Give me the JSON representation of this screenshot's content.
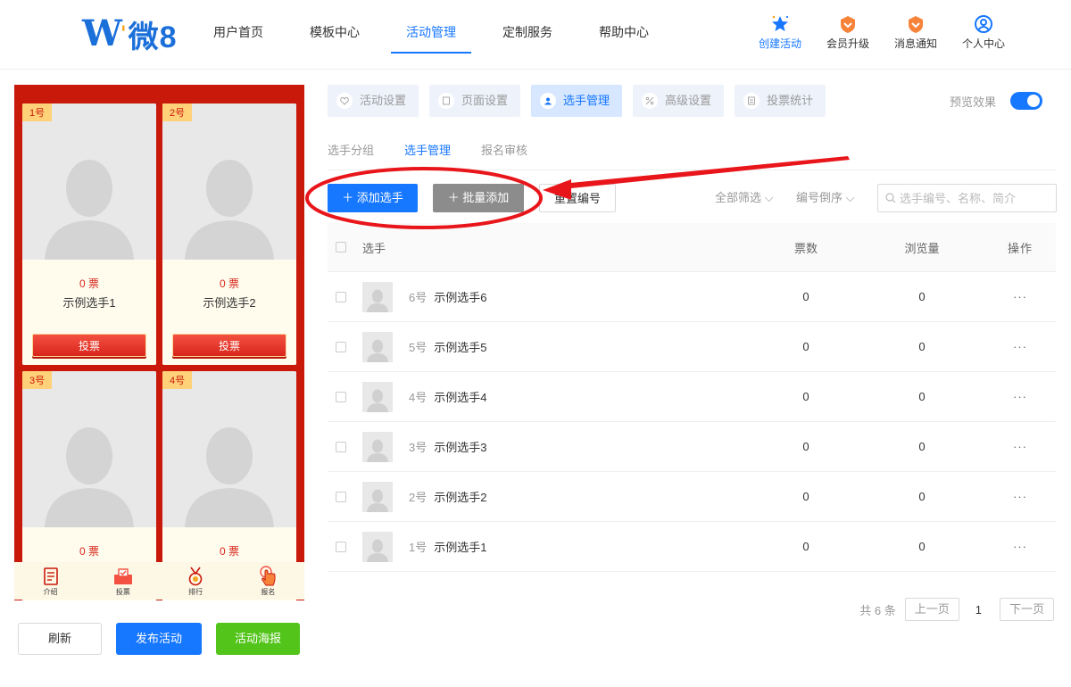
{
  "header": {
    "logo_text": "微8",
    "nav": [
      "用户首页",
      "模板中心",
      "活动管理",
      "定制服务",
      "帮助中心"
    ],
    "icons": [
      {
        "label": "创建活动",
        "icon": "star-icon"
      },
      {
        "label": "会员升级",
        "icon": "upgrade-icon"
      },
      {
        "label": "消息通知",
        "icon": "message-icon"
      },
      {
        "label": "个人中心",
        "icon": "user-icon"
      }
    ]
  },
  "preview": {
    "cards": [
      {
        "num": "1号",
        "votes": "0 票",
        "name": "示例选手1",
        "vote_btn": "投票"
      },
      {
        "num": "2号",
        "votes": "0 票",
        "name": "示例选手2",
        "vote_btn": "投票"
      },
      {
        "num": "3号",
        "votes": "0 票"
      },
      {
        "num": "4号",
        "votes": "0 票"
      }
    ],
    "bottom_bar": [
      "介绍",
      "投票",
      "排行",
      "报名"
    ]
  },
  "left_buttons": {
    "refresh": "刷新",
    "publish": "发布活动",
    "poster": "活动海报"
  },
  "top_tabs": [
    "活动设置",
    "页面设置",
    "选手管理",
    "高级设置",
    "投票统计"
  ],
  "preview_toggle_label": "预览效果",
  "sub_tabs": [
    "选手分组",
    "选手管理",
    "报名审核"
  ],
  "toolbar": {
    "add": "＋ 添加选手",
    "batch": "＋ 批量添加",
    "reset": "重置编号",
    "filter": "全部筛选",
    "sort": "编号倒序",
    "search_placeholder": "选手编号、名称、简介"
  },
  "table": {
    "headers": {
      "player": "选手",
      "votes": "票数",
      "views": "浏览量",
      "ops": "操作"
    },
    "rows": [
      {
        "num": "6号",
        "name": "示例选手6",
        "votes": "0",
        "views": "0",
        "ops": "···"
      },
      {
        "num": "5号",
        "name": "示例选手5",
        "votes": "0",
        "views": "0",
        "ops": "···"
      },
      {
        "num": "4号",
        "name": "示例选手4",
        "votes": "0",
        "views": "0",
        "ops": "···"
      },
      {
        "num": "3号",
        "name": "示例选手3",
        "votes": "0",
        "views": "0",
        "ops": "···"
      },
      {
        "num": "2号",
        "name": "示例选手2",
        "votes": "0",
        "views": "0",
        "ops": "···"
      },
      {
        "num": "1号",
        "name": "示例选手1",
        "votes": "0",
        "views": "0",
        "ops": "···"
      }
    ]
  },
  "pager": {
    "total": "共 6 条",
    "prev": "上一页",
    "current": "1",
    "next": "下一页"
  },
  "colors": {
    "primary": "#1677ff",
    "phone_bg": "#c9190b",
    "annotation": "#e8161b",
    "poster_btn": "#52c41a"
  }
}
